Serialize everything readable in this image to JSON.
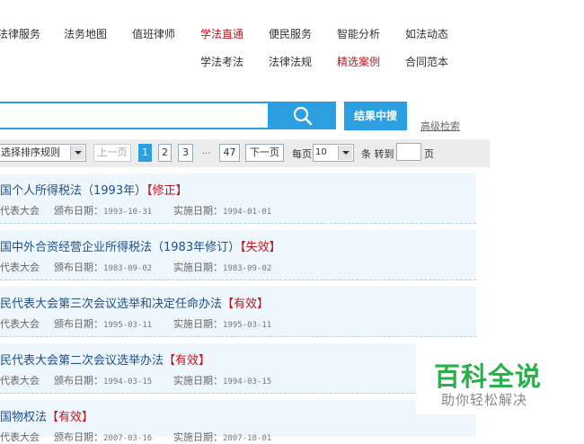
{
  "nav": {
    "row1": [
      "法律服务",
      "法务地图",
      "值班律师",
      "学法直通",
      "便民服务",
      "智能分析",
      "如法动态"
    ],
    "row2": [
      "学法考法",
      "法律法规",
      "精选案例",
      "合同范本"
    ]
  },
  "search": {
    "button_label": "结果中搜",
    "advanced_label": "高级检索"
  },
  "pager": {
    "sort_label": "选择排序规则",
    "prev_label": "上一页",
    "pages": [
      "1",
      "2",
      "3"
    ],
    "ellipsis": "...",
    "last_page": "47",
    "next_label": "下一页",
    "per_page_label": "每页",
    "per_page_value": "10",
    "goto_prefix": "条 转到",
    "goto_suffix": "页"
  },
  "results": [
    {
      "title": "国个人所得税法（1993年）",
      "tag": "【修正】",
      "issuer": "代表大会",
      "issue_label": "颁布日期：",
      "issue_date": "1993-10-31",
      "effective_label": "实施日期：",
      "effective_date": "1994-01-01"
    },
    {
      "title": "国中外合资经营企业所得税法（1983年修订）",
      "tag": "【失效】",
      "issuer": "代表大会",
      "issue_label": "颁布日期：",
      "issue_date": "1983-09-02",
      "effective_label": "实施日期：",
      "effective_date": "1983-09-02"
    },
    {
      "title": "民代表大会第三次会议选举和决定任命办法",
      "tag": "【有效】",
      "issuer": "代表大会",
      "issue_label": "颁布日期：",
      "issue_date": "1995-03-11",
      "effective_label": "实施日期：",
      "effective_date": "1995-03-11"
    },
    {
      "title": "民代表大会第二次会议选举办法",
      "tag": "【有效】",
      "issuer": "代表大会",
      "issue_label": "颁布日期：",
      "issue_date": "1994-03-15",
      "effective_label": "实施日期：",
      "effective_date": "1994-03-15"
    },
    {
      "title": "国物权法",
      "tag": "【有效】",
      "issuer": "代表大会",
      "issue_label": "颁布日期：",
      "issue_date": "2007-03-16",
      "effective_label": "实施日期：",
      "effective_date": "2007-10-01"
    }
  ],
  "watermark": {
    "main": "百科全说",
    "sub": "助你轻松解决"
  },
  "colors": {
    "accent": "#2b9fe0",
    "nav_red": "#c0161c",
    "row_bg": "#eef7fd",
    "watermark_green": "#2ab04a"
  },
  "icons": {
    "search": "search-icon",
    "dropdown": "chevron-down-icon"
  }
}
